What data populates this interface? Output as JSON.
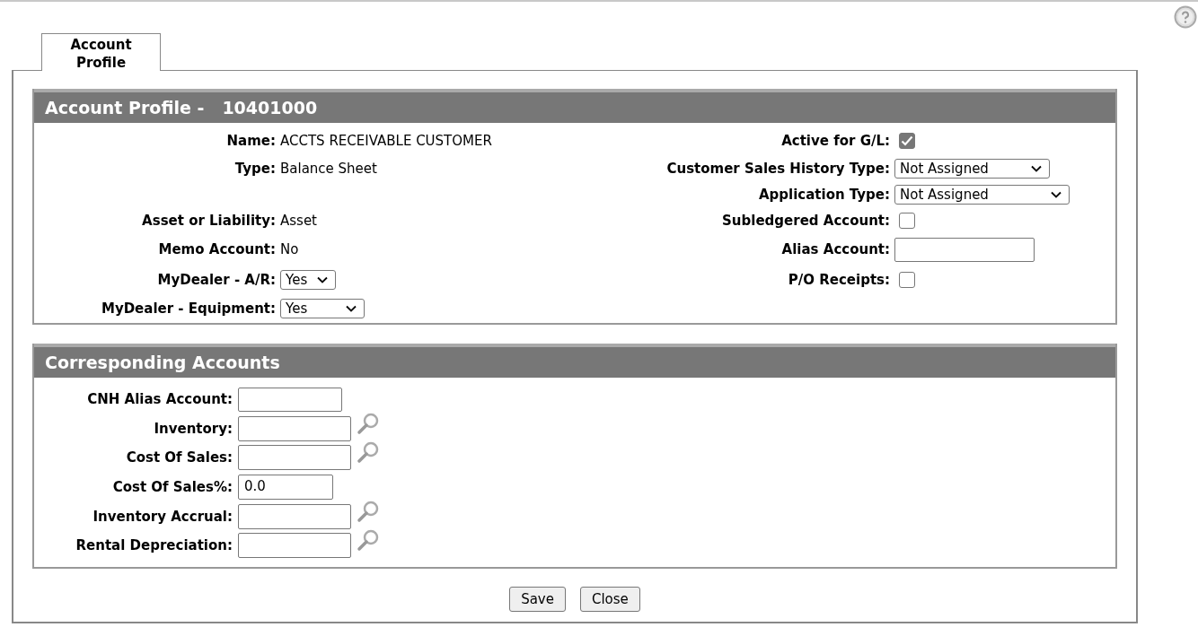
{
  "tabs": [
    {
      "label": "Account Profile",
      "selected": true
    }
  ],
  "profile": {
    "title": "Account Profile -",
    "account_number": "10401000",
    "rows": [
      {
        "left": {
          "kind": "text",
          "label": "Name:",
          "value": "ACCTS RECEIVABLE CUSTOMER"
        },
        "right": {
          "kind": "checkbox",
          "label": "Active for G/L:",
          "checked": true,
          "disabled": true
        }
      },
      {
        "left": {
          "kind": "text",
          "label": "Type:",
          "value": "Balance Sheet"
        },
        "right": {
          "kind": "select",
          "label": "Customer Sales History Type:",
          "value": "Not Assigned"
        }
      },
      {
        "right": {
          "kind": "select",
          "label": "Application Type:",
          "value": "Not Assigned"
        }
      },
      {
        "left": {
          "kind": "text",
          "label": "Asset or Liability:",
          "value": "Asset"
        },
        "right": {
          "kind": "checkbox",
          "label": "Subledgered Account:",
          "checked": false,
          "disabled": false
        }
      },
      {
        "left": {
          "kind": "text",
          "label": "Memo Account:",
          "value": "No"
        },
        "right": {
          "kind": "input",
          "label": "Alias Account:"
        }
      },
      {
        "left": {
          "kind": "select",
          "label": "MyDealer - A/R:",
          "value": "Yes"
        },
        "right": {
          "kind": "checkbox",
          "label": "P/O Receipts:",
          "checked": false,
          "disabled": false
        }
      },
      {
        "left": {
          "kind": "select",
          "label": "MyDealer - Equipment:",
          "value": "Yes"
        }
      }
    ]
  },
  "corresponding": {
    "title": "Corresponding Accounts",
    "fields": [
      {
        "label": "CNH Alias Account:",
        "lookup": false
      },
      {
        "label": "Inventory:",
        "lookup": true
      },
      {
        "label": "Cost Of Sales:",
        "lookup": true
      },
      {
        "label": "Cost Of Sales%:",
        "value": "0.0",
        "lookup": false
      },
      {
        "label": "Inventory Accrual:",
        "lookup": true
      },
      {
        "label": "Rental Depreciation:",
        "lookup": true
      }
    ]
  },
  "buttons": [
    "Save",
    "Close"
  ]
}
